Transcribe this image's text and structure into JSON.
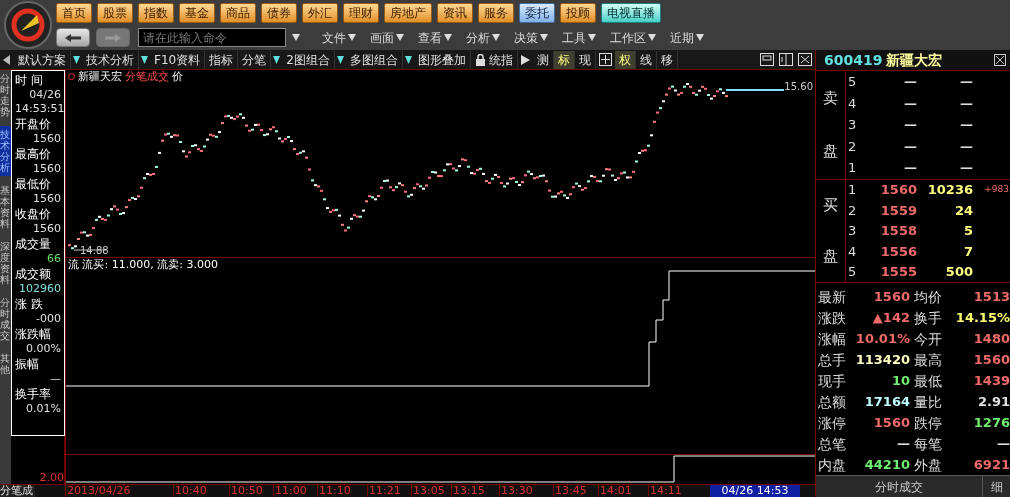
{
  "nav_buttons": [
    {
      "label": "首页",
      "kind": "orange"
    },
    {
      "label": "股票",
      "kind": "orange"
    },
    {
      "label": "指数",
      "kind": "orange"
    },
    {
      "label": "基金",
      "kind": "orange"
    },
    {
      "label": "商品",
      "kind": "orange"
    },
    {
      "label": "债券",
      "kind": "orange"
    },
    {
      "label": "外汇",
      "kind": "orange"
    },
    {
      "label": "理财",
      "kind": "orange"
    },
    {
      "label": "房地产",
      "kind": "orange"
    },
    {
      "label": "资讯",
      "kind": "orange"
    },
    {
      "label": "服务",
      "kind": "orange"
    },
    {
      "label": "委托",
      "kind": "blue"
    },
    {
      "label": "投顾",
      "kind": "orange"
    },
    {
      "label": "电视直播",
      "kind": "teal"
    }
  ],
  "command_box": {
    "placeholder": "请在此输入命令"
  },
  "menus": [
    "文件",
    "画面",
    "查看",
    "分析",
    "决策",
    "工具",
    "工作区",
    "近期"
  ],
  "toolbar": [
    {
      "label": "默认方案",
      "dropdown": true,
      "highlighted": false
    },
    {
      "label": "技术分析",
      "dropdown": true,
      "highlighted": false
    },
    {
      "label": "F10资料",
      "dropdown": false,
      "highlighted": false
    },
    {
      "label": "指标",
      "dropdown": false,
      "highlighted": false
    },
    {
      "label": "分笔",
      "dropdown": true,
      "highlighted": false
    },
    {
      "label": "2图组合",
      "dropdown": true,
      "highlighted": false
    },
    {
      "label": "多图组合",
      "dropdown": true,
      "highlighted": false
    },
    {
      "label": "图形叠加",
      "dropdown": false,
      "highlighted": false
    },
    {
      "label": "统指",
      "dropdown": false,
      "highlighted": false,
      "kind": "lock"
    },
    {
      "label": "测",
      "dropdown": false,
      "highlighted": false,
      "kind": "play"
    },
    {
      "label": "标",
      "dropdown": false,
      "highlighted": true
    },
    {
      "label": "现",
      "dropdown": false,
      "highlighted": false
    },
    {
      "label": "权",
      "dropdown": false,
      "highlighted": true,
      "kind": "grid"
    },
    {
      "label": "线",
      "dropdown": false,
      "highlighted": false
    },
    {
      "label": "移",
      "dropdown": false,
      "highlighted": false
    }
  ],
  "stock_header": {
    "code": "600419",
    "name": "新疆大宏"
  },
  "side_tabs": [
    {
      "label": "分时走势",
      "selected": false
    },
    {
      "label": "技术分析",
      "selected": true
    },
    {
      "label": "基本资料",
      "selected": false
    },
    {
      "label": "深度资料",
      "selected": false
    },
    {
      "label": "分时成交",
      "selected": false
    },
    {
      "label": "其他",
      "selected": false
    }
  ],
  "info_panel": [
    {
      "label": "时 间",
      "values": [
        "04/26",
        "14:53:51"
      ],
      "color": "#e0e0e0"
    },
    {
      "label": "开盘价",
      "values": [
        "1560"
      ],
      "color": "#e0e0e0"
    },
    {
      "label": "最高价",
      "values": [
        "1560"
      ],
      "color": "#e0e0e0"
    },
    {
      "label": "最低价",
      "values": [
        "1560"
      ],
      "color": "#e0e0e0"
    },
    {
      "label": "收盘价",
      "values": [
        "1560"
      ],
      "color": "#e0e0e0"
    },
    {
      "label": "成交量",
      "values": [
        "66"
      ],
      "color": "#60e060"
    },
    {
      "label": "成交额",
      "values": [
        "102960"
      ],
      "color": "#80e0e0"
    },
    {
      "label": "涨 跌",
      "values": [
        "-000"
      ],
      "color": "#e0e0e0"
    },
    {
      "label": "涨跌幅",
      "values": [
        "0.00%"
      ],
      "color": "#e0e0e0"
    },
    {
      "label": "振幅",
      "values": [
        "—"
      ]
    },
    {
      "label": "换手率",
      "values": [
        "0.01%"
      ],
      "color": "#e0e0e0"
    }
  ],
  "chart": {
    "title": "新疆天宏",
    "mode": "分笔成交",
    "field": "价",
    "high_label": "15.60",
    "low_label": "14.88"
  },
  "flow_panel": {
    "legend": "流 流买: 11.000, 流卖: 3.000",
    "axis_label": "2.00"
  },
  "bottom_tab": "分笔成",
  "time_axis": [
    "2013/04/26",
    "10:40",
    "10:50",
    "11:00",
    "11:10",
    "11:21",
    "13:05",
    "13:15",
    "13:30",
    "13:45",
    "14:01",
    "14:11"
  ],
  "cursor_time": "04/26 14:53",
  "order_book": {
    "sell_label": [
      "卖",
      "盘"
    ],
    "buy_label": [
      "买",
      "盘"
    ],
    "buy_note": "+983",
    "sell": [
      {
        "rank": "5",
        "price": "—",
        "volume": "—"
      },
      {
        "rank": "4",
        "price": "—",
        "volume": "—"
      },
      {
        "rank": "3",
        "price": "—",
        "volume": "—"
      },
      {
        "rank": "2",
        "price": "—",
        "volume": "—"
      },
      {
        "rank": "1",
        "price": "—",
        "volume": "—"
      }
    ],
    "buy": [
      {
        "rank": "1",
        "price": "1560",
        "volume": "10236"
      },
      {
        "rank": "2",
        "price": "1559",
        "volume": "24"
      },
      {
        "rank": "3",
        "price": "1558",
        "volume": "5"
      },
      {
        "rank": "4",
        "price": "1556",
        "volume": "7"
      },
      {
        "rank": "5",
        "price": "1555",
        "volume": "500"
      }
    ]
  },
  "stats": [
    [
      {
        "label": "最新",
        "value": "1560",
        "color": "#f06a6a"
      },
      {
        "label": "均价",
        "value": "1513",
        "color": "#f06a6a"
      }
    ],
    [
      {
        "label": "涨跌",
        "value": "▲142",
        "color": "#f06a6a"
      },
      {
        "label": "换手",
        "value": "14.15%",
        "color": "#ffff70"
      }
    ],
    [
      {
        "label": "涨幅",
        "value": "10.01%",
        "color": "#f06a6a"
      },
      {
        "label": "今开",
        "value": "1480",
        "color": "#f06a6a"
      }
    ],
    [
      {
        "label": "总手",
        "value": "113420",
        "color": "#ffffc0"
      },
      {
        "label": "最高",
        "value": "1560",
        "color": "#f06a6a"
      }
    ],
    [
      {
        "label": "现手",
        "value": "10",
        "color": "#70f070"
      },
      {
        "label": "最低",
        "value": "1439",
        "color": "#f06a6a"
      }
    ],
    [
      {
        "label": "总额",
        "value": "17164",
        "color": "#c0ffff"
      },
      {
        "label": "量比",
        "value": "2.91",
        "color": "#e0e0e0"
      }
    ],
    [
      {
        "label": "涨停",
        "value": "1560",
        "color": "#f06a6a"
      },
      {
        "label": "跌停",
        "value": "1276",
        "color": "#70f070"
      }
    ],
    [
      {
        "label": "总笔",
        "value": "—",
        "color": "#e0e0e0"
      },
      {
        "label": "每笔",
        "value": "—",
        "color": "#e0e0e0"
      }
    ],
    [
      {
        "label": "内盘",
        "value": "44210",
        "color": "#70f070"
      },
      {
        "label": "外盘",
        "value": "6921",
        "color": "#f06a6a"
      }
    ]
  ],
  "bottom_tabs": [
    "分时成交",
    "细"
  ]
}
